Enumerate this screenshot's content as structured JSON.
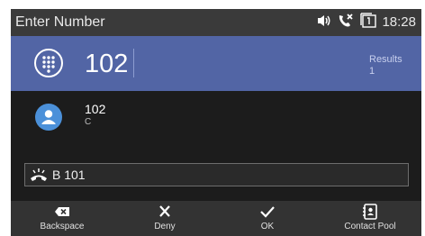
{
  "status_bar": {
    "title": "Enter Number",
    "time": "18:28",
    "icons": [
      "speaker-icon",
      "missed-call-icon",
      "call-log-icon"
    ]
  },
  "entry": {
    "value": "102",
    "results_label": "Results",
    "results_count": "1"
  },
  "results": [
    {
      "name": "102",
      "sub": "C",
      "icon": "contact-avatar-icon"
    }
  ],
  "line": {
    "label": "B 101",
    "icon": "handset-icon"
  },
  "softkeys": [
    {
      "label": "Backspace",
      "icon": "backspace-icon"
    },
    {
      "label": "Deny",
      "icon": "close-icon"
    },
    {
      "label": "OK",
      "icon": "check-icon"
    },
    {
      "label": "Contact Pool",
      "icon": "address-book-icon"
    }
  ],
  "colors": {
    "entry_bar": "#5265a5",
    "avatar": "#4b90d9",
    "background": "#1c1c1c"
  }
}
